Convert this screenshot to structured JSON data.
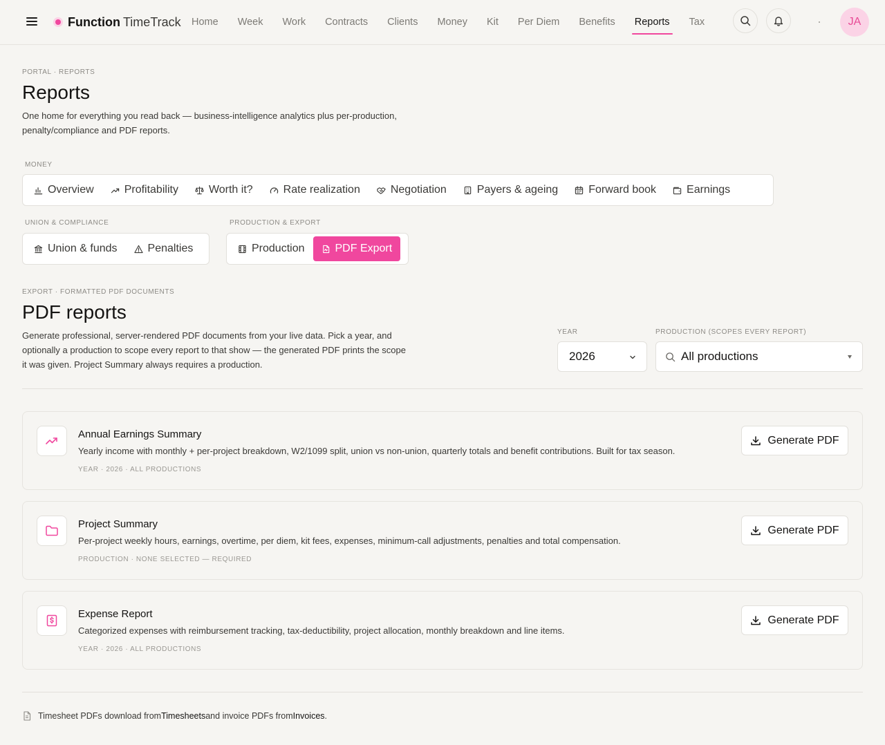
{
  "app": {
    "brand_bold": "Function",
    "brand_light": "TimeTrack",
    "avatar_initials": "JA",
    "accent_color": "#f0479e"
  },
  "nav": {
    "items": [
      {
        "label": "Home"
      },
      {
        "label": "Week"
      },
      {
        "label": "Work"
      },
      {
        "label": "Contracts"
      },
      {
        "label": "Clients"
      },
      {
        "label": "Money"
      },
      {
        "label": "Kit"
      },
      {
        "label": "Per Diem"
      },
      {
        "label": "Benefits"
      },
      {
        "label": "Reports",
        "active": true
      },
      {
        "label": "Tax"
      }
    ]
  },
  "page": {
    "breadcrumb": "PORTAL · REPORTS",
    "title": "Reports",
    "description": "One home for everything you read back — business-intelligence analytics plus per-production, penalty/compliance and PDF reports."
  },
  "tab_groups": {
    "money": {
      "label": "MONEY",
      "tabs": [
        {
          "label": "Overview",
          "icon": "bar-chart-icon"
        },
        {
          "label": "Profitability",
          "icon": "trending-up-icon"
        },
        {
          "label": "Worth it?",
          "icon": "scale-icon"
        },
        {
          "label": "Rate realization",
          "icon": "gauge-icon"
        },
        {
          "label": "Negotiation",
          "icon": "handshake-icon"
        },
        {
          "label": "Payers & ageing",
          "icon": "building-icon"
        },
        {
          "label": "Forward book",
          "icon": "calendar-icon"
        },
        {
          "label": "Earnings",
          "icon": "wallet-icon"
        }
      ]
    },
    "union": {
      "label": "UNION & COMPLIANCE",
      "tabs": [
        {
          "label": "Union & funds",
          "icon": "landmark-icon"
        },
        {
          "label": "Penalties",
          "icon": "warning-icon"
        }
      ]
    },
    "production": {
      "label": "PRODUCTION & EXPORT",
      "tabs": [
        {
          "label": "Production",
          "icon": "film-icon"
        },
        {
          "label": "PDF Export",
          "icon": "file-pdf-icon",
          "active": true
        }
      ]
    }
  },
  "pdf_section": {
    "eyebrow": "EXPORT · FORMATTED PDF DOCUMENTS",
    "title": "PDF reports",
    "description": "Generate professional, server-rendered PDF documents from your live data. Pick a year, and optionally a production to scope every report to that show — the generated PDF prints the scope it was given. Project Summary always requires a production.",
    "year_label": "YEAR",
    "year_value": "2026",
    "production_label": "PRODUCTION (SCOPES EVERY REPORT)",
    "production_value": "All productions"
  },
  "reports": [
    {
      "title": "Annual Earnings Summary",
      "description": "Yearly income with monthly + per-project breakdown, W2/1099 split, union vs non-union, quarterly totals and benefit contributions. Built for tax season.",
      "meta": "YEAR · 2026 · ALL PRODUCTIONS",
      "button_label": "Generate PDF",
      "icon": "trending-up-icon"
    },
    {
      "title": "Project Summary",
      "description": "Per-project weekly hours, earnings, overtime, per diem, kit fees, expenses, minimum-call adjustments, penalties and total compensation.",
      "meta": "PRODUCTION · NONE SELECTED — REQUIRED",
      "button_label": "Generate PDF",
      "icon": "folder-icon"
    },
    {
      "title": "Expense Report",
      "description": "Categorized expenses with reimbursement tracking, tax-deductibility, project allocation, monthly breakdown and line items.",
      "meta": "YEAR · 2026 · ALL PRODUCTIONS",
      "button_label": "Generate PDF",
      "icon": "receipt-icon"
    }
  ],
  "footer": {
    "text_1": "Timesheet PDFs download from ",
    "link_1": "Timesheets",
    "text_2": " and invoice PDFs from ",
    "link_2": "Invoices",
    "text_3": "."
  }
}
